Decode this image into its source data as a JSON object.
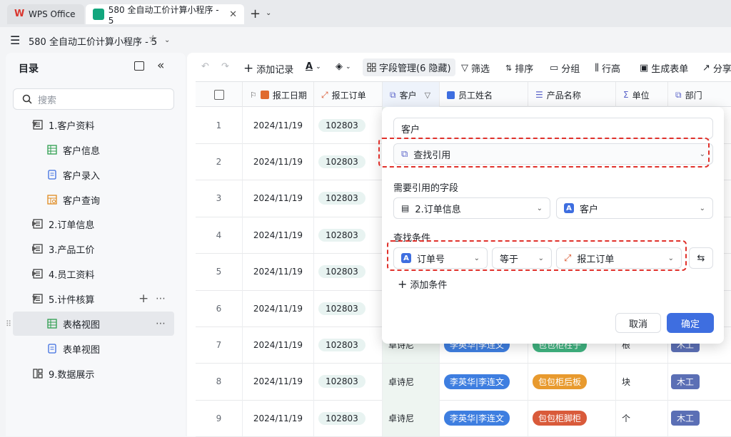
{
  "titlebar": {
    "tabs": [
      {
        "label": "WPS Office"
      },
      {
        "label": "580 全自动工价计算小程序 - 5"
      }
    ]
  },
  "doc_title": "580 全自动工价计算小程序 - 5",
  "sidebar": {
    "title": "目录",
    "search_placeholder": "搜索",
    "items": [
      {
        "label": "1.客户资料"
      },
      {
        "label": "客户信息"
      },
      {
        "label": "客户录入"
      },
      {
        "label": "客户查询"
      },
      {
        "label": "2.订单信息"
      },
      {
        "label": "3.产品工价"
      },
      {
        "label": "4.员工资料"
      },
      {
        "label": "5.计件核算"
      },
      {
        "label": "表格视图"
      },
      {
        "label": "表单视图"
      },
      {
        "label": "9.数据展示"
      }
    ]
  },
  "toolbar": {
    "add_record": "添加记录",
    "field_manage": "字段管理(6 隐藏)",
    "filter": "筛选",
    "sort": "排序",
    "group": "分组",
    "row_height": "行高",
    "gen_form": "生成表单",
    "share": "分享"
  },
  "grid": {
    "columns": [
      "报工日期",
      "报工订单",
      "客户",
      "员工姓名",
      "产品名称",
      "单位",
      "部门"
    ],
    "rows": [
      {
        "n": "1",
        "date": "2024/11/19",
        "order": "102803",
        "cust": "",
        "emp": "",
        "prod": "",
        "unit": "",
        "dept": ""
      },
      {
        "n": "2",
        "date": "2024/11/19",
        "order": "102803",
        "cust": "",
        "emp": "",
        "prod": "",
        "unit": "",
        "dept": ""
      },
      {
        "n": "3",
        "date": "2024/11/19",
        "order": "102803",
        "cust": "",
        "emp": "",
        "prod": "",
        "unit": "",
        "dept": ""
      },
      {
        "n": "4",
        "date": "2024/11/19",
        "order": "102803",
        "cust": "",
        "emp": "",
        "prod": "",
        "unit": "",
        "dept": ""
      },
      {
        "n": "5",
        "date": "2024/11/19",
        "order": "102803",
        "cust": "",
        "emp": "",
        "prod": "",
        "unit": "",
        "dept": ""
      },
      {
        "n": "6",
        "date": "2024/11/19",
        "order": "102803",
        "cust": "",
        "emp": "",
        "prod": "",
        "unit": "",
        "dept": ""
      },
      {
        "n": "7",
        "date": "2024/11/19",
        "order": "102803",
        "cust": "卓诗尼",
        "emp": "李英华|李连文",
        "prod": "包包柜柱子",
        "unit": "根",
        "dept": "木工"
      },
      {
        "n": "8",
        "date": "2024/11/19",
        "order": "102803",
        "cust": "卓诗尼",
        "emp": "李英华|李连文",
        "prod": "包包柜后板",
        "unit": "块",
        "dept": "木工"
      },
      {
        "n": "9",
        "date": "2024/11/19",
        "order": "102803",
        "cust": "卓诗尼",
        "emp": "李英华|李连文",
        "prod": "包包柜脚柜",
        "unit": "个",
        "dept": "木工"
      }
    ]
  },
  "popup": {
    "field_name": "客户",
    "field_type": "查找引用",
    "ref_label": "需要引用的字段",
    "ref_table": "2.订单信息",
    "ref_field": "客户",
    "cond_label": "查找条件",
    "cond_field": "订单号",
    "cond_op": "等于",
    "cond_value": "报工订单",
    "add_cond": "添加条件",
    "cancel": "取消",
    "confirm": "确定"
  },
  "colors": {
    "accent": "#3e6ee0",
    "highlight": "#e0312b"
  }
}
